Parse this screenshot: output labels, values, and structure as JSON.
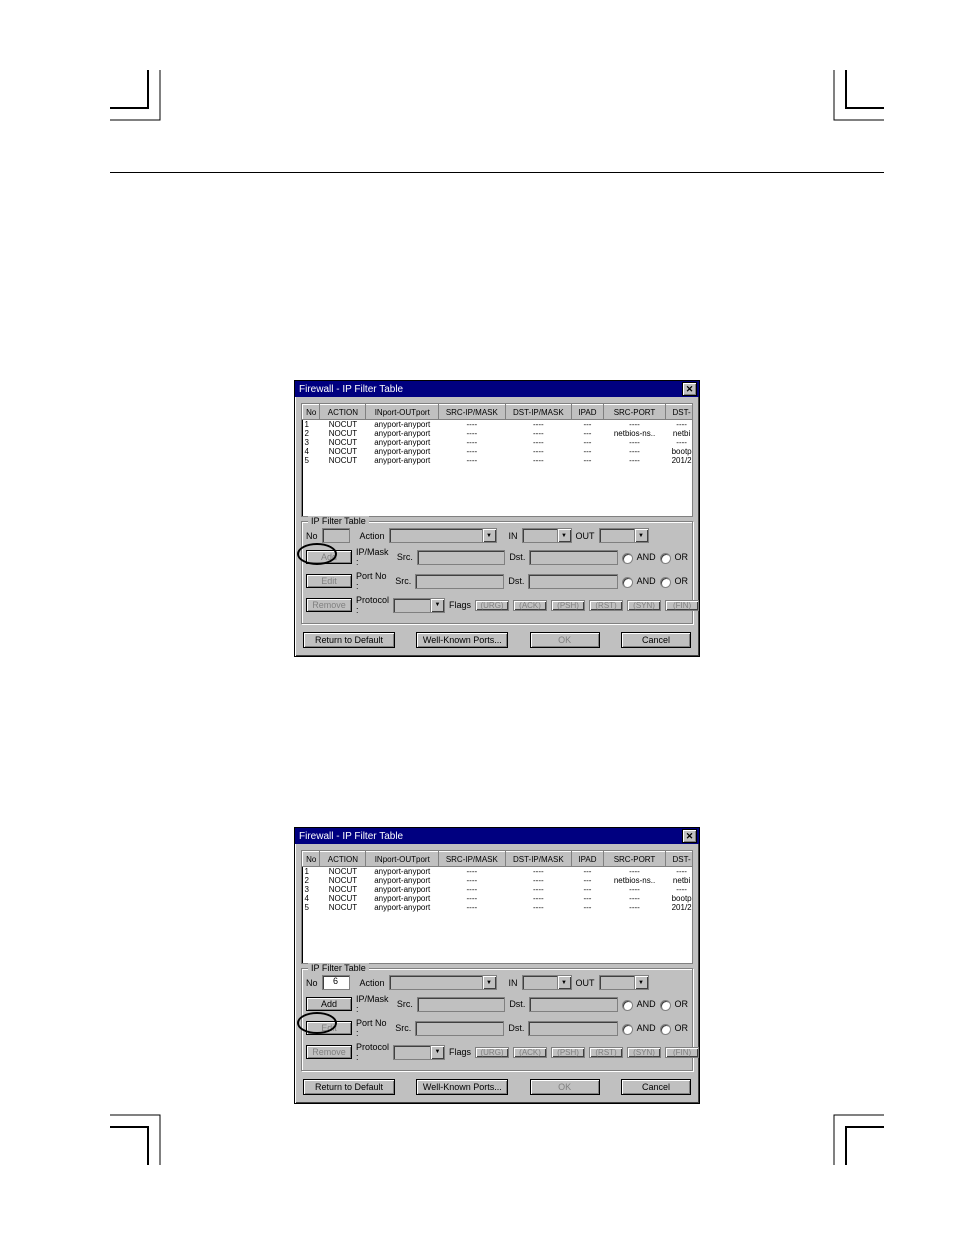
{
  "dialog_title": "Firewall - IP Filter Table",
  "table": {
    "headers": [
      "No",
      "ACTION",
      "INport-OUTport",
      "SRC-IP/MASK",
      "DST-IP/MASK",
      "IPAD",
      "SRC-PORT",
      "DST-"
    ],
    "rows": [
      {
        "no": "1",
        "action": "NOCUT",
        "inout": "anyport-anyport",
        "src": "----",
        "dst": "----",
        "ipad": "---",
        "srcport": "----",
        "dstp": "----"
      },
      {
        "no": "2",
        "action": "NOCUT",
        "inout": "anyport-anyport",
        "src": "----",
        "dst": "----",
        "ipad": "---",
        "srcport": "netbios-ns..",
        "dstp": "netbi"
      },
      {
        "no": "3",
        "action": "NOCUT",
        "inout": "anyport-anyport",
        "src": "----",
        "dst": "----",
        "ipad": "---",
        "srcport": "----",
        "dstp": "----"
      },
      {
        "no": "4",
        "action": "NOCUT",
        "inout": "anyport-anyport",
        "src": "----",
        "dst": "----",
        "ipad": "---",
        "srcport": "----",
        "dstp": "bootp"
      },
      {
        "no": "5",
        "action": "NOCUT",
        "inout": "anyport-anyport",
        "src": "----",
        "dst": "----",
        "ipad": "---",
        "srcport": "----",
        "dstp": "201/2"
      }
    ]
  },
  "fieldset_legend": "IP Filter Table",
  "labels": {
    "no": "No",
    "action": "Action",
    "in": "IN",
    "out": "OUT",
    "ipmask": "IP/Mask :",
    "src": "Src.",
    "dst": "Dst.",
    "portno": "Port No :",
    "protocol": "Protocol :",
    "flags": "Flags",
    "and": "AND",
    "or": "OR"
  },
  "buttons": {
    "add": "Add",
    "edit": "Edit",
    "remove": "Remove",
    "return_default": "Return to Default",
    "wellknown": "Well-Known Ports...",
    "ok": "OK",
    "cancel": "Cancel"
  },
  "flags": [
    "(URG)",
    "(ACK)",
    "(PSH)",
    "(RST)",
    "(SYN)",
    "(FIN)"
  ],
  "dlg2_no_value": "6"
}
